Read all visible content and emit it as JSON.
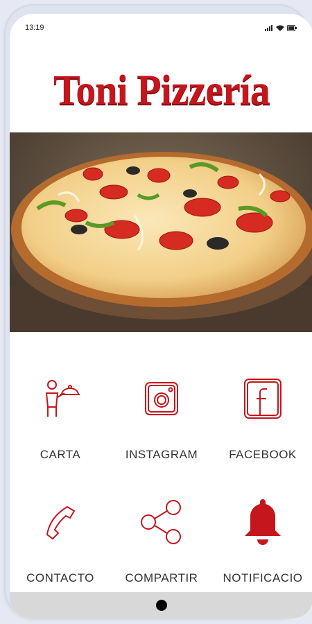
{
  "status": {
    "time": "13:19",
    "signal_icon": "signal-icon",
    "wifi_icon": "wifi-icon",
    "battery_icon": "battery-icon"
  },
  "brand": {
    "logo_text": "Toni Pizzería",
    "color": "#c4161c"
  },
  "hero": {
    "image": "pizza-photo"
  },
  "menu": {
    "items": [
      {
        "label": "CARTA",
        "icon": "waiter-icon"
      },
      {
        "label": "INSTAGRAM",
        "icon": "instagram-icon"
      },
      {
        "label": "FACEBOOK",
        "icon": "facebook-icon"
      },
      {
        "label": "CONTACTO",
        "icon": "phone-icon"
      },
      {
        "label": "COMPARTIR",
        "icon": "share-icon"
      },
      {
        "label": "NOTIFICACIO",
        "icon": "bell-icon"
      }
    ]
  },
  "navbar": {
    "home_icon": "home-button"
  }
}
